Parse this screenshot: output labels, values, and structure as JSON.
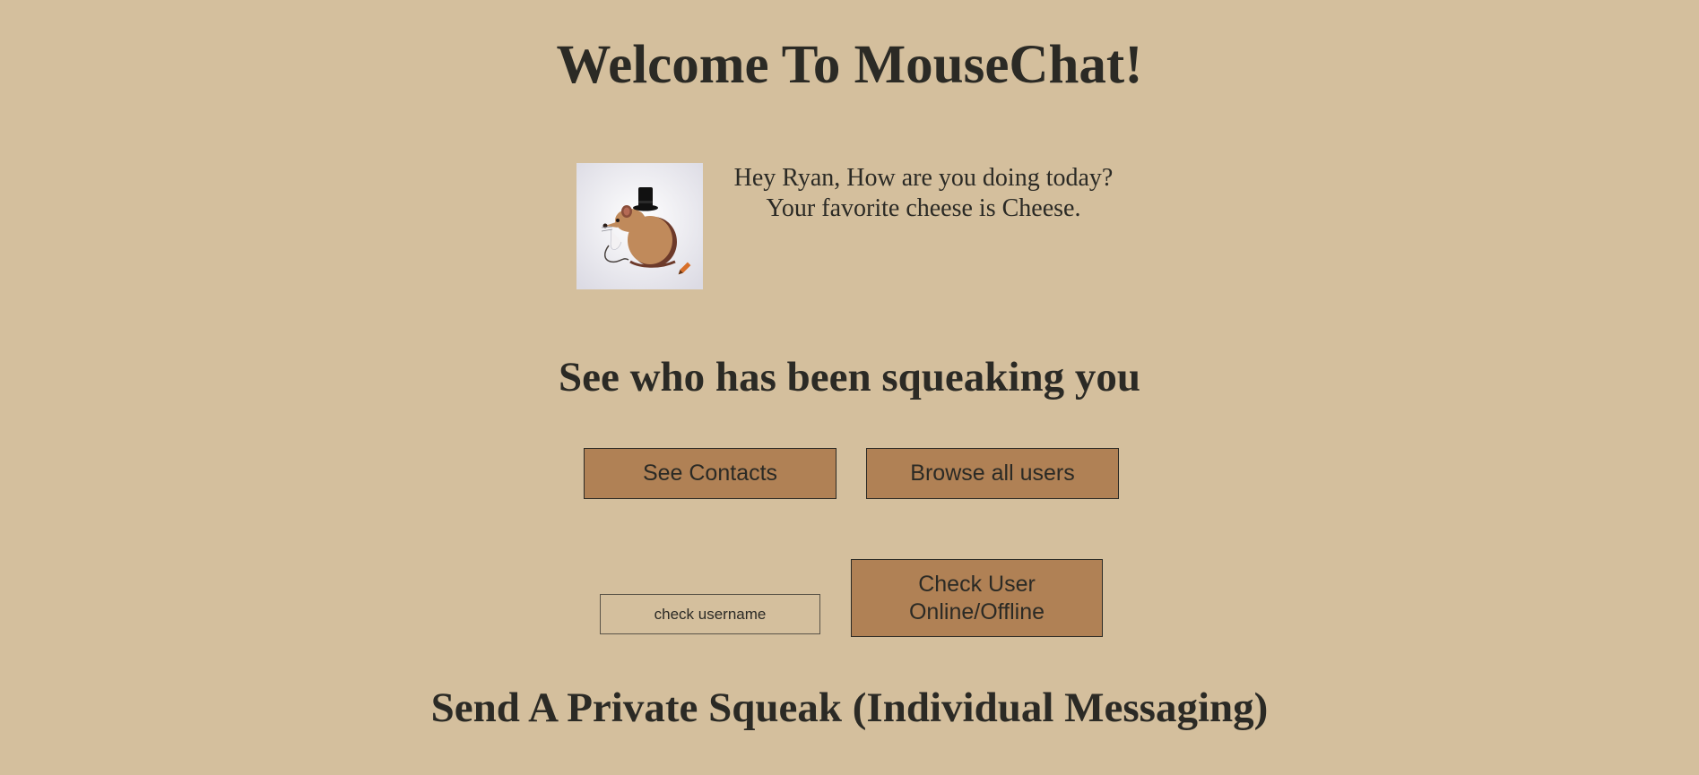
{
  "page": {
    "title": "Welcome To MouseChat!"
  },
  "profile": {
    "avatar_icon": "mouse-with-top-hat-icon",
    "edit_icon": "pencil-icon",
    "greeting_line1": "Hey Ryan, How are you doing today?",
    "greeting_line2": "Your favorite cheese is Cheese."
  },
  "squeaks": {
    "title": "See who has been squeaking you",
    "see_contacts_label": "See Contacts",
    "browse_users_label": "Browse all users"
  },
  "status_check": {
    "username_placeholder": "check username",
    "username_value": "",
    "check_button_label": "Check User Online/Offline"
  },
  "private": {
    "title": "Send A Private Squeak (Individual Messaging)"
  },
  "colors": {
    "background": "#d4bf9d",
    "button": "#b08155",
    "text": "#2b2a25"
  }
}
